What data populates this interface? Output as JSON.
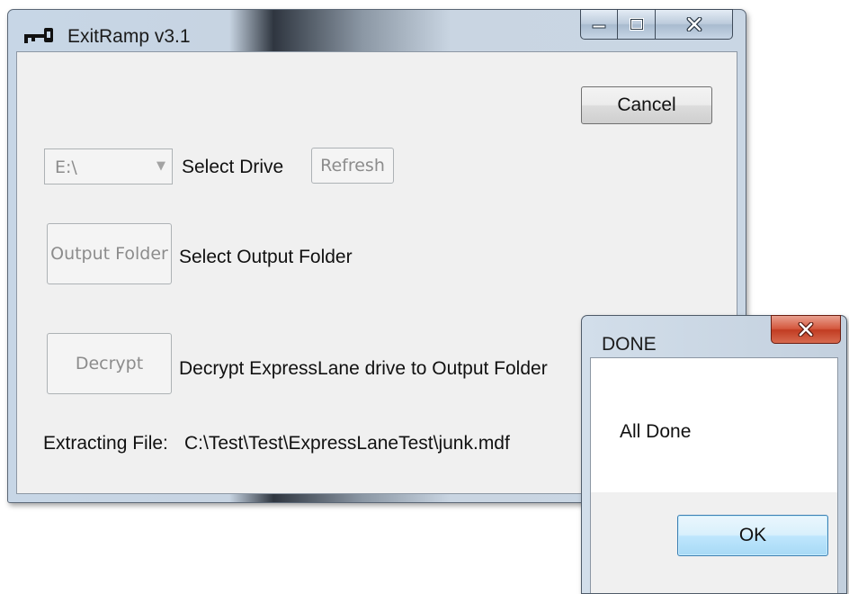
{
  "main_window": {
    "title": "ExitRamp v3.1",
    "icon": "key-icon",
    "caption_buttons": [
      "minimize-icon",
      "maximize-icon",
      "close-icon"
    ],
    "cancel_label": "Cancel",
    "drive_select": {
      "value": "E:\\",
      "disabled": true
    },
    "select_drive_label": "Select Drive",
    "refresh_label": "Refresh",
    "output_folder_button_label": "Output Folder",
    "output_folder_label": "Select Output Folder",
    "decrypt_button_label": "Decrypt",
    "decrypt_label": "Decrypt ExpressLane drive to Output Folder",
    "extracting_label": "Extracting File:",
    "extracting_path": "C:\\Test\\Test\\ExpressLaneTest\\junk.mdf"
  },
  "dialog": {
    "title": "DONE",
    "message": "All Done",
    "ok_label": "OK",
    "close_icon": "close-icon"
  },
  "colors": {
    "dialog_close_red": "#c94a31",
    "ok_button_blue": "#bee6fd",
    "window_frame": "#c7d6e6"
  }
}
